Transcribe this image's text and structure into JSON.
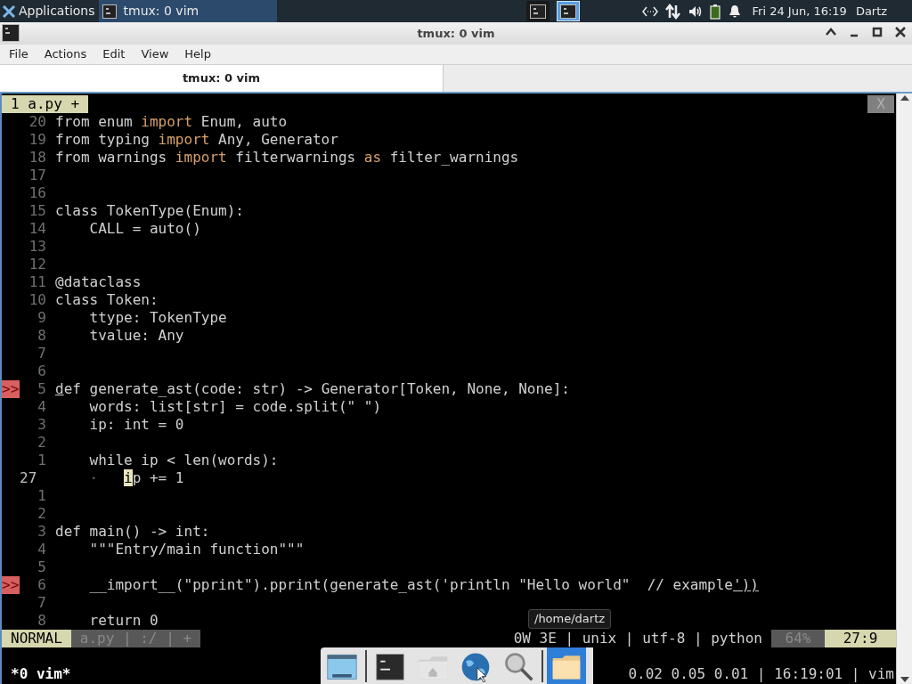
{
  "top_panel": {
    "menu_label": "Applications",
    "task": {
      "title": "tmux: 0 vim",
      "selected": true
    },
    "workspaces": [
      {
        "selected": false
      },
      {
        "selected": true
      }
    ],
    "clock": "Fri 24 Jun, 16:19",
    "user": "Dartz"
  },
  "window": {
    "title": "tmux: 0 vim",
    "menu": [
      "File",
      "Actions",
      "Edit",
      "View",
      "Help"
    ],
    "tabs": [
      {
        "label": "tmux: 0 vim",
        "selected": true
      }
    ]
  },
  "tmux": {
    "window_tab": "1 a.py +",
    "close": "X",
    "status_left": "*0 vim*",
    "status_right": "0.02 0.05 0.01 | 16:19:01 | vim"
  },
  "editor": {
    "lines": [
      {
        "number": "20",
        "current": false,
        "code": [
          {
            "text": "from enum ",
            "kind": "plain"
          },
          {
            "text": "import",
            "kind": "keyword"
          },
          {
            "text": " Enum, auto",
            "kind": "plain"
          }
        ]
      },
      {
        "number": "19",
        "current": false,
        "code": [
          {
            "text": "from typing ",
            "kind": "plain"
          },
          {
            "text": "import",
            "kind": "keyword"
          },
          {
            "text": " Any, Generator",
            "kind": "plain"
          }
        ]
      },
      {
        "number": "18",
        "current": false,
        "code": [
          {
            "text": "from warnings ",
            "kind": "plain"
          },
          {
            "text": "import",
            "kind": "keyword"
          },
          {
            "text": " filterwarnings ",
            "kind": "plain"
          },
          {
            "text": "as",
            "kind": "keyword"
          },
          {
            "text": " filter_warnings",
            "kind": "plain"
          }
        ]
      },
      {
        "number": "17",
        "current": false
      },
      {
        "number": "16",
        "current": false
      },
      {
        "number": "15",
        "current": false,
        "code": [
          {
            "text": "class TokenType(Enum):",
            "kind": "plain"
          }
        ]
      },
      {
        "number": "14",
        "current": false,
        "code": [
          {
            "text": "    CALL = auto()",
            "kind": "plain"
          }
        ]
      },
      {
        "number": "13",
        "current": false
      },
      {
        "number": "12",
        "current": false
      },
      {
        "number": "11",
        "current": false,
        "code": [
          {
            "text": "@dataclass",
            "kind": "plain"
          }
        ]
      },
      {
        "number": "10",
        "current": false,
        "code": [
          {
            "text": "class Token:",
            "kind": "plain"
          }
        ]
      },
      {
        "number": "9",
        "current": false,
        "code": [
          {
            "text": "    ttype: TokenType",
            "kind": "plain"
          }
        ]
      },
      {
        "number": "8",
        "current": false,
        "code": [
          {
            "text": "    tvalue: Any",
            "kind": "plain"
          }
        ]
      },
      {
        "number": "7",
        "current": false
      },
      {
        "number": "6",
        "current": false
      },
      {
        "number": "5",
        "current": false,
        "sign": ">>",
        "code": [
          {
            "text": "d",
            "kind": "match"
          },
          {
            "text": "ef generate_ast(code: str) -> Generator[Token, None, None]:",
            "kind": "plain"
          }
        ]
      },
      {
        "number": "4",
        "current": false,
        "code": [
          {
            "text": "    words: list[str] = code.split(\" \")",
            "kind": "plain"
          }
        ]
      },
      {
        "number": "3",
        "current": false,
        "code": [
          {
            "text": "    ip: int = 0",
            "kind": "plain"
          }
        ]
      },
      {
        "number": "2",
        "current": false
      },
      {
        "number": "1",
        "current": false,
        "code": [
          {
            "text": "    while ip < len(words):",
            "kind": "plain"
          }
        ]
      },
      {
        "number": "27",
        "current": true,
        "code": [
          {
            "text": "    ·   ",
            "kind": "dim"
          },
          {
            "text": "i",
            "kind": "cursor"
          },
          {
            "text": "p += 1",
            "kind": "plain"
          }
        ]
      },
      {
        "number": "1",
        "current": false
      },
      {
        "number": "2",
        "current": false
      },
      {
        "number": "3",
        "current": false,
        "code": [
          {
            "text": "def main() -> int:",
            "kind": "plain"
          }
        ]
      },
      {
        "number": "4",
        "current": false,
        "code": [
          {
            "text": "    \"\"\"Entry/main function\"\"\"",
            "kind": "plain"
          }
        ]
      },
      {
        "number": "5",
        "current": false
      },
      {
        "number": "6",
        "current": false,
        "sign": ">>",
        "code": [
          {
            "text": "    __import__(\"pprint\").pprint(generate_ast('println \"Hello world\"  // example",
            "kind": "plain"
          },
          {
            "text": "'))",
            "kind": "match"
          }
        ]
      },
      {
        "number": "7",
        "current": false
      },
      {
        "number": "8",
        "current": false,
        "code": [
          {
            "text": "    return 0",
            "kind": "plain"
          }
        ]
      }
    ]
  },
  "statusline": {
    "mode": "NORMAL",
    "file": "a.py | :/ | +",
    "info": "0W 3E | unix | utf-8 | python",
    "percent": "64%",
    "position": "27:9"
  },
  "dock": {
    "items": [
      {
        "kind": "window",
        "selected": false
      },
      {
        "kind": "separator"
      },
      {
        "kind": "terminal",
        "selected": false
      },
      {
        "kind": "home",
        "selected": false
      },
      {
        "kind": "globe",
        "selected": false
      },
      {
        "kind": "search",
        "selected": false
      },
      {
        "kind": "separator"
      },
      {
        "kind": "folder",
        "selected": true
      }
    ],
    "tooltip": "/home/dartz"
  }
}
